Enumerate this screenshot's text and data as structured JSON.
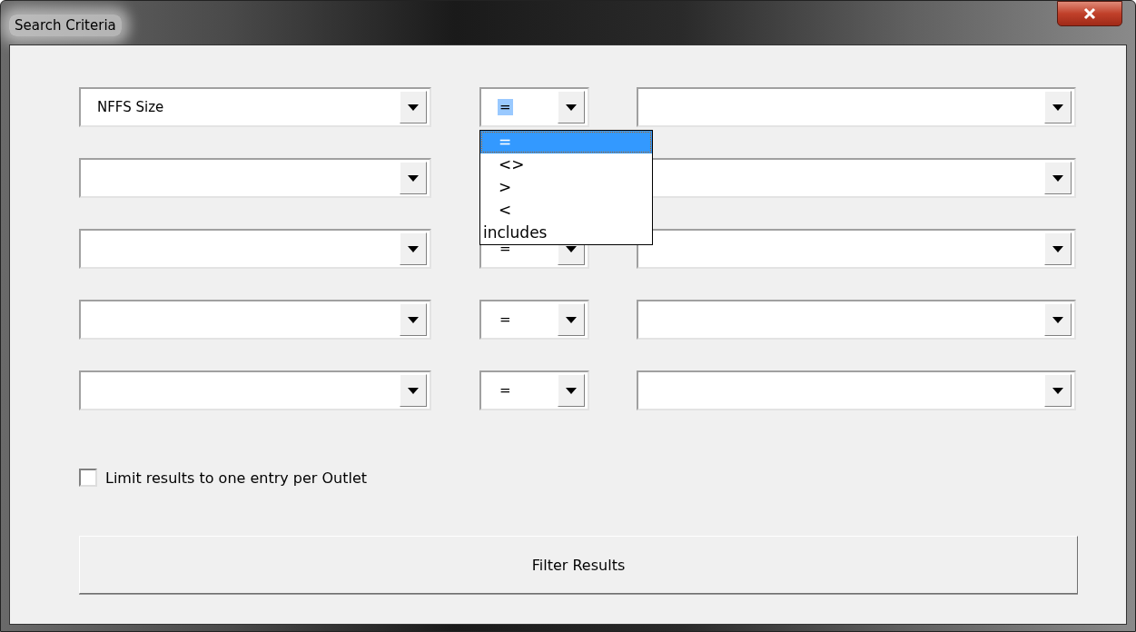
{
  "window": {
    "title": "Search Criteria"
  },
  "criteria": [
    {
      "kind": "criterion",
      "field": "NFFS Size",
      "operator": "=",
      "operator_menu": {
        "options": [
          {
            "label": "=",
            "selected": true
          },
          {
            "label": "<>",
            "selected": false
          },
          {
            "label": ">",
            "selected": false
          },
          {
            "label": "<",
            "selected": false
          },
          {
            "label": "includes",
            "selected": false
          }
        ]
      }
    },
    {
      "kind": "criterion"
    },
    {
      "kind": "criterion",
      "operator": "="
    },
    {
      "kind": "criterion",
      "operator": "="
    },
    {
      "kind": "criterion",
      "operator": "="
    }
  ],
  "limit_checkbox": {
    "label": "Limit results to one entry per Outlet",
    "checked": false
  },
  "filter_button": {
    "label": "Filter Results"
  }
}
